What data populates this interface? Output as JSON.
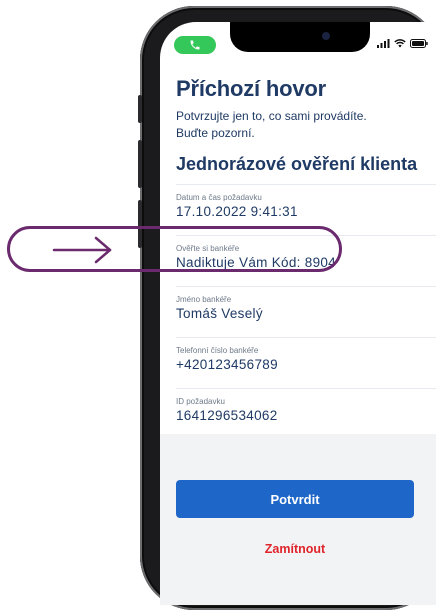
{
  "colors": {
    "title": "#1f3a64",
    "primary_button": "#1e66c8",
    "reject_text": "#e0242a",
    "call_pill": "#34c759",
    "highlight": "#6b2a6e"
  },
  "status_bar": {
    "call_icon": "phone-icon",
    "signal_icon": "signal-icon",
    "wifi_icon": "wifi-icon",
    "battery_icon": "battery-icon"
  },
  "header": {
    "title": "Příchozí hovor",
    "warning_line1": "Potvrzujte jen to, co sami provádíte.",
    "warning_line2": "Buďte pozorní.",
    "subtitle": "Jednorázové ověření klienta"
  },
  "details": [
    {
      "label": "Datum a čas požadavku",
      "value": "17.10.2022 9:41:31"
    },
    {
      "label": "Ověřte si bankéře",
      "value": "Nadiktuje Vám Kód: 8904"
    },
    {
      "label": "Jméno bankéře",
      "value": "Tomáš Veselý"
    },
    {
      "label": "Telefonní číslo bankéře",
      "value": "+420123456789"
    },
    {
      "label": "ID požadavku",
      "value": "1641296534062"
    }
  ],
  "actions": {
    "confirm_label": "Potvrdit",
    "reject_label": "Zamítnout"
  },
  "annotation": {
    "arrow_icon": "arrow-right-icon"
  }
}
